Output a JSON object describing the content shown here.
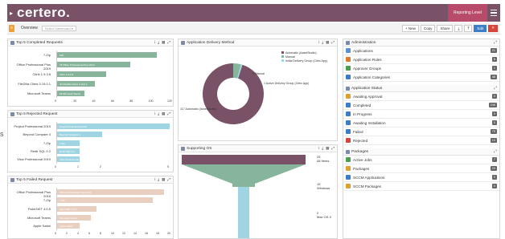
{
  "app": {
    "logo": "certero.",
    "reporting_level": "Reporting Level"
  },
  "toolbar": {
    "overview": "Overview",
    "dashboard_select": "Select Dashboard",
    "new": "+ New",
    "copy": "Copy",
    "share": "Share",
    "edit": "Edit"
  },
  "left_cut_text": "s",
  "completed": {
    "title": "Top 5 Completed Requests",
    "color": "#86b59c",
    "rows": [
      {
        "label": "7-Zip",
        "value": 106,
        "bar_text": "106"
      },
      {
        "label": "Office Professional Plus 2019",
        "value": 78,
        "bar_text": "78 Office Professional Plus 2019"
      },
      {
        "label": "Citrix 1.9.3.8",
        "value": 52,
        "bar_text": "Citrix 1.9.3.8"
      },
      {
        "label": "FileZilla Client 3.19.0.1",
        "value": 40,
        "bar_text": "40 FileZilla Client 3.19.0.1"
      },
      {
        "label": "Microsoft Teams",
        "value": 29,
        "bar_text": "29 Microsoft Teams"
      }
    ],
    "ticks": [
      "0",
      "20",
      "40",
      "60",
      "80",
      "100",
      "120"
    ],
    "max": 120
  },
  "rejected": {
    "title": "Top 5 Rejected Request",
    "color": "#9fd5e2",
    "rows": [
      {
        "label": "Project Professional 2019",
        "value": 5,
        "bar_text": "Project Professional 2019"
      },
      {
        "label": "Beyond Compare 4",
        "value": 2,
        "bar_text": "Beyond Compare 4"
      },
      {
        "label": "7-Zip",
        "value": 1,
        "bar_text": "7-Zip"
      },
      {
        "label": "Redit SQL 9.2",
        "value": 1,
        "bar_text": "Redit SQL 9.2"
      },
      {
        "label": "Visio Professional 2019",
        "value": 1,
        "bar_text": "Visio Professional 2019"
      }
    ],
    "ticks": [
      "0",
      "1",
      "2",
      "5"
    ],
    "max": 5
  },
  "failed": {
    "title": "Top 5 Failed Request",
    "color": "#e8cfbf",
    "rows": [
      {
        "label": "Office Professional Plus 2016",
        "value": 19,
        "bar_text": "Office Professional Plus 2016"
      },
      {
        "label": "7-Zip",
        "value": 17,
        "bar_text": "7-Zip"
      },
      {
        "label": "Paint.NET 4.0.5",
        "value": 7,
        "bar_text": "Paint.NET 4.0.5"
      },
      {
        "label": "Microsoft Teams",
        "value": 6,
        "bar_text": "Microsoft Teams"
      },
      {
        "label": "Apple Safari",
        "value": 4,
        "bar_text": "Apple Safari"
      }
    ],
    "ticks": [
      "0",
      "2",
      "4",
      "6",
      "8",
      "10",
      "12",
      "14",
      "16",
      "18",
      "20"
    ],
    "max": 20
  },
  "delivery": {
    "title": "Application Delivery Method",
    "legend": [
      {
        "label": "Automatic (AssetStudio)",
        "color": "#7a5267"
      },
      {
        "label": "Manual",
        "color": "#86b59c"
      },
      {
        "label": "Initial Delivery Group (Citrix App)",
        "color": "#9fd5e2"
      }
    ],
    "chart_data": {
      "type": "pie",
      "values": [
        117,
        5,
        1
      ],
      "labels": [
        "117 Automatic (AssetStudio)",
        "5 Manual",
        "1 Active Delivery Group (Citrix App)"
      ]
    }
  },
  "os": {
    "title": "Supporting OS",
    "labels": [
      {
        "n": "25",
        "t": "All Items"
      },
      {
        "n": "15",
        "t": "Windows"
      },
      {
        "n": "2",
        "t": "Mac OS X"
      }
    ]
  },
  "admin": {
    "title": "Administration",
    "items": [
      {
        "label": "Applications",
        "count": "21",
        "color": "#5b8fd6"
      },
      {
        "label": "Application Rules",
        "count": "6",
        "color": "#e07a2a"
      },
      {
        "label": "Approver Groups",
        "count": "1",
        "color": "#4aa04a"
      },
      {
        "label": "Application Categories",
        "count": "48",
        "color": "#3b7dc8"
      }
    ]
  },
  "status": {
    "title": "Application Status",
    "items": [
      {
        "label": "Awaiting Approval",
        "count": "0",
        "color": "#e0a030"
      },
      {
        "label": "Completed",
        "count": "249",
        "color": "#3b7dc8"
      },
      {
        "label": "In Progress",
        "count": "0",
        "color": "#3b7dc8"
      },
      {
        "label": "Awaiting Installation",
        "count": "0",
        "color": "#3b7dc8"
      },
      {
        "label": "Failed",
        "count": "79",
        "color": "#3b7dc8"
      },
      {
        "label": "Rejected",
        "count": "10",
        "color": "#d9443a"
      }
    ]
  },
  "packages": {
    "title": "Packages",
    "items": [
      {
        "label": "Active Jobs",
        "count": "7",
        "color": "#4aa04a"
      },
      {
        "label": "Packages",
        "count": "23",
        "color": "#e0a030"
      },
      {
        "label": "SCCM Applications",
        "count": "0",
        "color": "#3b7dc8"
      },
      {
        "label": "SCCM Packages",
        "count": "0",
        "color": "#e0a030"
      }
    ]
  }
}
